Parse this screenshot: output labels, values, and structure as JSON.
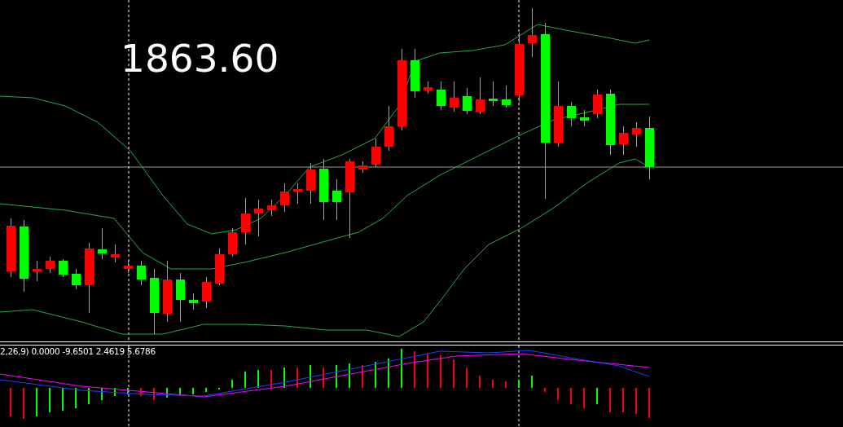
{
  "chart": {
    "price_label": "1863.60",
    "indicator_label": "2,26,9) 0.0000 -9.6501 2.4619 5.6786"
  }
}
